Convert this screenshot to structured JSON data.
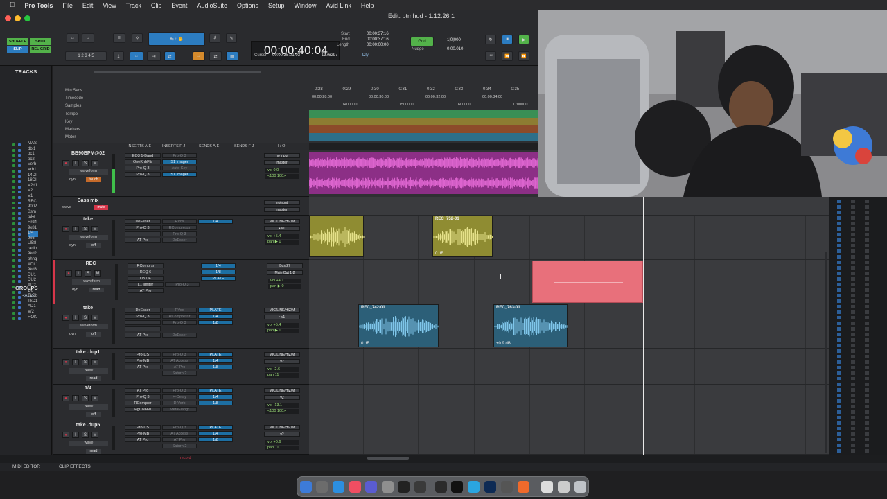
{
  "menubar": {
    "apple": "",
    "app": "Pro Tools",
    "items": [
      "File",
      "Edit",
      "View",
      "Track",
      "Clip",
      "Event",
      "AudioSuite",
      "Options",
      "Setup",
      "Window",
      "Avid Link",
      "Help"
    ]
  },
  "window": {
    "title": "Edit: ptmhud - 1.12.26 1"
  },
  "toolbar": {
    "modes": [
      "SHUFFLE",
      "SPOT",
      "SLIP",
      "REL GRID"
    ],
    "counter_main": "00:00:40:04",
    "start_label": "Start",
    "end_label": "End",
    "length_label": "Length",
    "start_val": "00:00:37:16",
    "end_val": "00:00:37:16",
    "length_val": "00:00:00:00",
    "cursor_label": "Cursor",
    "cursor_val": "00:00:35:01.03",
    "samples_val": "1376297",
    "grid_label": "Grid",
    "grid_val": "1|0|000",
    "nudge_label": "Nudge",
    "nudge_val": "0:00.010",
    "dly": "Dly"
  },
  "tracklist": {
    "title": "TRACKS",
    "groups_title": "GROUPS",
    "groups_all": "<ALL>",
    "names": [
      "MAS",
      "dbl1",
      "pc1",
      "pc2",
      "Verb",
      "Vrb1",
      "14DI",
      "18DI",
      "V2d1",
      "V2",
      "V1",
      "REC",
      "9002",
      "Bsm",
      "take",
      "Hrd4",
      "9x81",
      "1/4",
      "9x6",
      "LIB8",
      "radio",
      "9kd2",
      "phng",
      "ADL1",
      "9kd3",
      "DU1",
      "DU2",
      "AD2",
      "1/8",
      "TkDb",
      "TkD1",
      "AD1",
      "V/2",
      "HOK"
    ]
  },
  "rulers": [
    "Min:Secs",
    "Timecode",
    "Samples",
    "Tempo",
    "Key",
    "Markers",
    "Meter"
  ],
  "ruler_ticks": {
    "minsecs": [
      "0:28",
      "0:29",
      "0:30",
      "0:31",
      "0:32",
      "0:33",
      "0:34",
      "0:35"
    ],
    "tc": [
      "00:00:28:00",
      "00:00:30:00",
      "00:00:32:00",
      "00:00:34:00"
    ],
    "samples": [
      "1400000",
      "1500000",
      "1600000",
      "1700000"
    ]
  },
  "mixhdr": [
    "INSERTS A-E",
    "INSERTS F-J",
    "SENDS A-E",
    "SENDS F-J",
    "I / O"
  ],
  "tracks": [
    {
      "name": "BB90BPM@02",
      "inserts": [
        "EQ3 1-Band",
        "OneKnbFltr",
        "Pro-Q 3",
        "Pro-Q 3"
      ],
      "insertsf": [
        "Pro-Q 3",
        "S1 Imager",
        "Auto-Key",
        "S1 Imager"
      ],
      "io_in": "no input",
      "io_out": "master",
      "vol": "vol   0.0",
      "pan": "<100   100>",
      "auto": "touch",
      "view": "waveform",
      "dyn": "dyn"
    },
    {
      "name": "Bass mix",
      "inserts": [],
      "insertsf": [],
      "io_in": "noinput",
      "io_out": "master",
      "vol": "0.0",
      "pan": "P",
      "auto": "mute",
      "view": "wave",
      "dyn": ""
    },
    {
      "name": "take",
      "inserts": [
        "DeEsser",
        "Pro-Q 3",
        "",
        "AT Pro"
      ],
      "insertsf": [
        "RVox",
        "RCompressr",
        "Pro-Q 3",
        "DeEsser"
      ],
      "io_in": "MIC/LINE/HIZ/M",
      "io_out": "• v1",
      "vol": "vol   +5.4",
      "pan": "pan   ▶ 0",
      "auto": "off",
      "view": "waveform",
      "dyn": "dyn",
      "send": "1/4"
    },
    {
      "name": "REC",
      "inserts": [
        "RComprsr",
        "REQ 6",
        "D3 DE",
        "L1 limiter",
        "AT Pro"
      ],
      "insertsf": [
        "",
        "",
        "",
        "Pro-Q 3",
        ""
      ],
      "io_in": "Bus 27",
      "io_out": "Main Out 1-2",
      "vol": "vol   +4.1",
      "pan": "pan   ▶ 0",
      "auto": "read",
      "view": "waveform",
      "dyn": "dyn",
      "send": "1/4",
      "send2": "1/8",
      "send3": "PLATE"
    },
    {
      "name": "take",
      "inserts": [
        "DeEsser",
        "Pro-Q 3",
        "",
        "",
        "AT Pro"
      ],
      "insertsf": [
        "RVox",
        "RCompressr",
        "Pro-Q 3",
        "",
        "DeEsser"
      ],
      "io_in": "MIC/LINE/HIZ/M",
      "io_out": "• v1",
      "vol": "vol   +5.4",
      "pan": "pan   ▶ 0",
      "auto": "off",
      "view": "waveform",
      "dyn": "dyn",
      "send": "PLATE",
      "send2": "1/4",
      "send3": "1/8"
    },
    {
      "name": "take .dup1",
      "inserts": [
        "Pro-DS",
        "Pro-MB",
        "AT Pro"
      ],
      "insertsf": [
        "Pro-Q 3",
        "AT Access",
        "AT Pro",
        "Saturn 2"
      ],
      "io_in": "MIC/LINE/HIZ/M",
      "io_out": "v2",
      "vol": "vol   -2.6",
      "pan": "pan   11",
      "auto": "read",
      "view": "wave",
      "dyn": "",
      "send": "PLATE",
      "send2": "1/4",
      "send3": "1/8"
    },
    {
      "name": "1/4",
      "inserts": [
        "AT Pro",
        "Pro-Q 3",
        "RComprsr",
        "PgCN660"
      ],
      "insertsf": [
        "Pro-Q 3",
        "H-Delay",
        "D-Verb",
        "MetaFlangr"
      ],
      "io_in": "MIC/LINE/HIZ/M",
      "io_out": "v2",
      "vol": "vol   -13.1",
      "pan": "<100   100>",
      "auto": "off",
      "view": "wave",
      "dyn": "",
      "send": "PLATE",
      "send2": "1/4",
      "send3": "1/8"
    },
    {
      "name": "take .dup5",
      "inserts": [
        "Pro-DS",
        "Pro-MB",
        "AT Pro"
      ],
      "insertsf": [
        "Pro-Q 3",
        "AT Access",
        "AT Pro",
        "Saturn 2"
      ],
      "io_in": "MIC/LINE/HIZ/M",
      "io_out": "v2",
      "vol": "vol   +0.6",
      "pan": "pan   11",
      "auto": "read",
      "view": "wave",
      "dyn": "",
      "send": "PLATE",
      "send2": "1/4",
      "send3": "1/8"
    }
  ],
  "clips": [
    {
      "name": "REC_752-01",
      "gain": "0 dB"
    },
    {
      "name": "REC_742-01",
      "gain": "0 dB"
    },
    {
      "name": "REC_763-01",
      "gain": "+0.9 dB"
    }
  ],
  "status": {
    "midi_editor": "MIDI EDITOR",
    "clip_effects": "CLIP EFFECTS",
    "record": "record"
  },
  "colors": {
    "accent_blue": "#2c7cc0",
    "record_red": "#d6364a",
    "clip_yellow": "#bdb94a",
    "clip_blue": "#3b7fa0",
    "clip_pink": "#e86f7a",
    "wave_pink": "#c14bb4"
  }
}
